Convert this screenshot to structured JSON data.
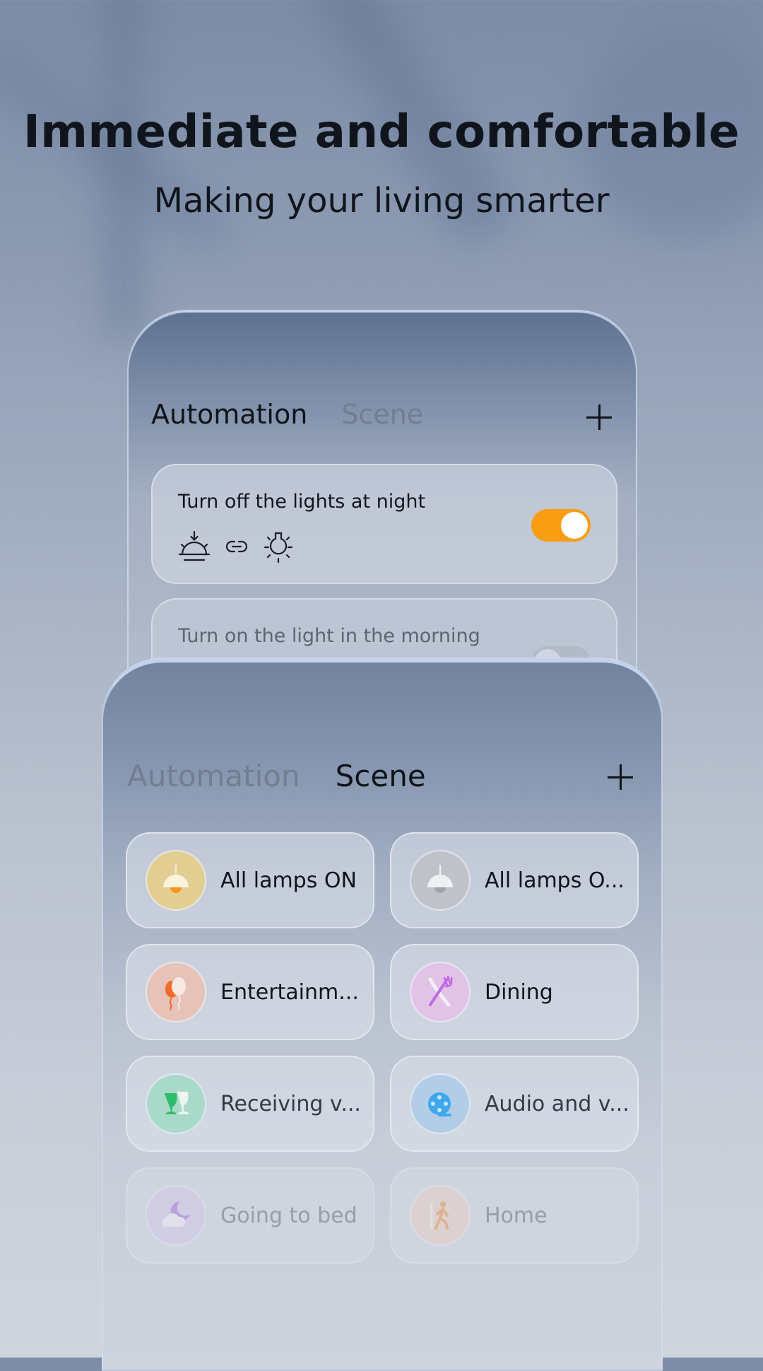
{
  "hero": {
    "title": "Immediate and comfortable",
    "subtitle": "Making your living smarter"
  },
  "automation_card": {
    "tabs": [
      {
        "label": "Automation",
        "active": true
      },
      {
        "label": "Scene",
        "active": false
      }
    ],
    "add_icon": "plus-icon",
    "items": [
      {
        "title": "Turn off the lights at night",
        "icons": [
          "sunset-icon",
          "link-icon",
          "light-bulb-icon"
        ],
        "enabled": true
      },
      {
        "title": "Turn on the light in the morning",
        "enabled": false
      }
    ],
    "toggle_on_color": "#f99d12"
  },
  "scene_card": {
    "tabs": [
      {
        "label": "Automation",
        "active": false
      },
      {
        "label": "Scene",
        "active": true
      }
    ],
    "add_icon": "plus-icon",
    "scenes": [
      {
        "label": "All lamps ON",
        "icon": "pendant-lamp-on-icon",
        "icon_bg": "#e2cd92"
      },
      {
        "label": "All lamps O...",
        "icon": "pendant-lamp-off-icon",
        "icon_bg": "#bfc2c9"
      },
      {
        "label": "Entertainm...",
        "icon": "balloons-icon",
        "icon_bg": "#e6c2b9"
      },
      {
        "label": "Dining",
        "icon": "knife-fork-icon",
        "icon_bg": "#e1c3e6"
      },
      {
        "label": "Receiving v...",
        "icon": "wine-glasses-icon",
        "icon_bg": "#a9dac9"
      },
      {
        "label": "Audio and v...",
        "icon": "film-reel-icon",
        "icon_bg": "#b3cde6"
      },
      {
        "label": "Going to bed",
        "icon": "moon-cloud-icon",
        "icon_bg": "#d6cbe9"
      },
      {
        "label": "Home",
        "icon": "walking-person-icon",
        "icon_bg": "#ead3c8"
      }
    ]
  }
}
